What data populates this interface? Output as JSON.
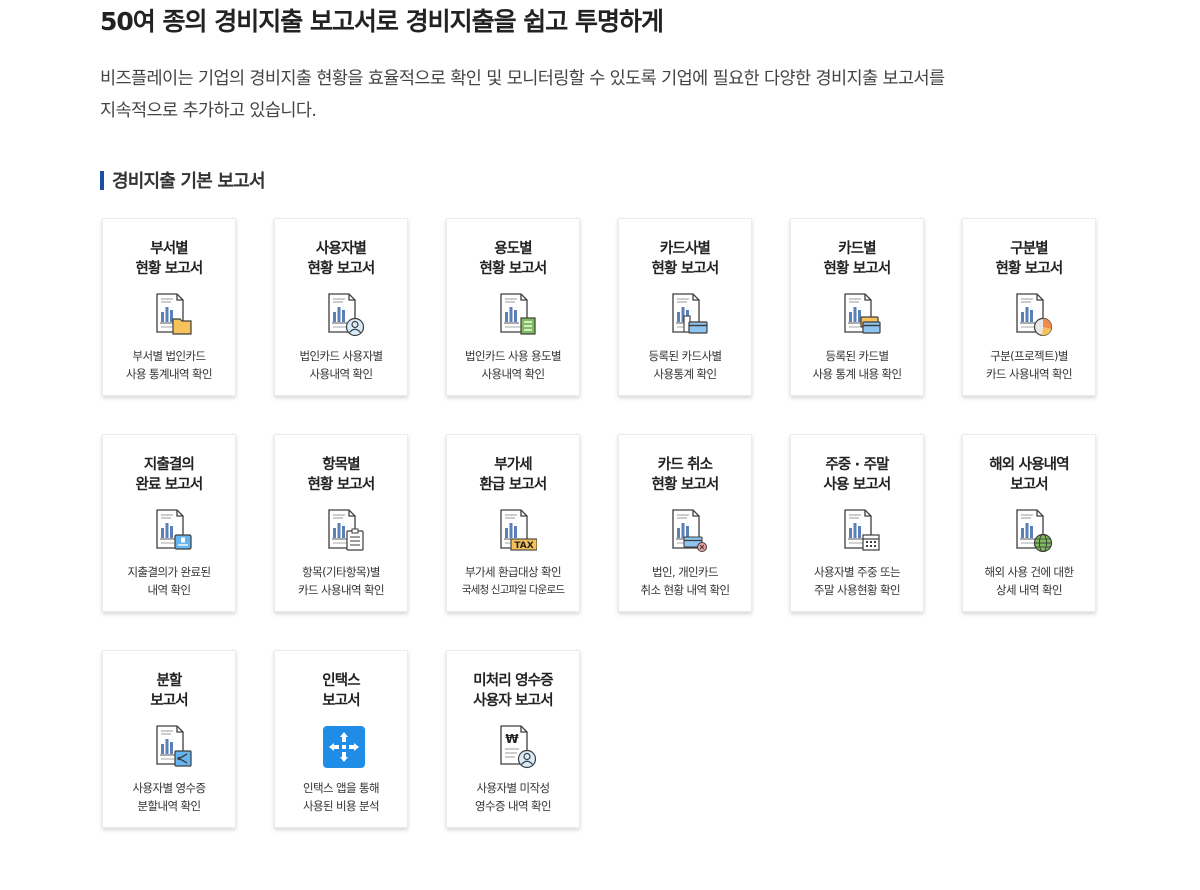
{
  "headline": "50여 종의 경비지출 보고서로 경비지출을 쉽고 투명하게",
  "intro": {
    "line1": "비즈플레이는 기업의 경비지출 현황을 효율적으로 확인 및 모니터링할 수 있도록 기업에 필요한 다양한 경비지출 보고서를",
    "line2": "지속적으로 추가하고 있습니다."
  },
  "section_title": "경비지출 기본 보고서",
  "colors": {
    "accent": "#1a4fa0",
    "doc_blue": "#5b7fb8",
    "folder_orange": "#f7c25c",
    "chart_green": "#7dbf5a",
    "intex_blue": "#1f8ce6"
  },
  "cards": [
    {
      "title1": "부서별",
      "title2": "현황 보고서",
      "desc1": "부서별 법인카드",
      "desc2": "사용 통계내역 확인",
      "icon": "folder-report-icon"
    },
    {
      "title1": "사용자별",
      "title2": "현황 보고서",
      "desc1": "법인카드 사용자별",
      "desc2": "사용내역 확인",
      "icon": "user-report-icon"
    },
    {
      "title1": "용도별",
      "title2": "현황 보고서",
      "desc1": "법인카드 사용 용도별",
      "desc2": "사용내역 확인",
      "icon": "list-report-icon"
    },
    {
      "title1": "카드사별",
      "title2": "현황 보고서",
      "desc1": "등록된 카드사별",
      "desc2": "사용통계 확인",
      "icon": "card-company-report-icon"
    },
    {
      "title1": "카드별",
      "title2": "현황 보고서",
      "desc1": "등록된 카드별",
      "desc2": "사용 통계 내용 확인",
      "icon": "cards-report-icon"
    },
    {
      "title1": "구분별",
      "title2": "현황 보고서",
      "desc1": "구분(프로젝트)별",
      "desc2": "카드 사용내역 확인",
      "icon": "pie-report-icon"
    },
    {
      "title1": "지출결의",
      "title2": "완료 보고서",
      "desc1": "지출결의가 완료된",
      "desc2": "내역 확인",
      "icon": "stamp-report-icon"
    },
    {
      "title1": "항목별",
      "title2": "현황 보고서",
      "desc1": "항목(기타항목)별",
      "desc2": "카드 사용내역 확인",
      "icon": "clipboard-report-icon"
    },
    {
      "title1": "부가세",
      "title2": "환급 보고서",
      "desc1": "부가세 환급대상 확인",
      "desc2": "국세청 신고파일 다운로드",
      "icon": "tax-report-icon",
      "tax_label": "TAX"
    },
    {
      "title1": "카드 취소",
      "title2": "현황 보고서",
      "desc1": "법인, 개인카드",
      "desc2": "취소 현황 내역 확인",
      "icon": "card-cancel-report-icon"
    },
    {
      "title1": "주중 · 주말",
      "title2": "사용 보고서",
      "desc1": "사용자별 주중 또는",
      "desc2": "주말 사용현황 확인",
      "icon": "calendar-report-icon"
    },
    {
      "title1": "해외 사용내역",
      "title2": "보고서",
      "desc1": "해외 사용 건에 대한",
      "desc2": "상세 내역 확인",
      "icon": "globe-report-icon"
    },
    {
      "title1": "분할",
      "title2": "보고서",
      "desc1": "사용자별 영수증",
      "desc2": "분할내역 확인",
      "icon": "split-report-icon"
    },
    {
      "title1": "인택스",
      "title2": "보고서",
      "desc1": "인택스 앱을 통해",
      "desc2": "사용된 비용 분석",
      "icon": "intex-app-icon"
    },
    {
      "title1": "미처리 영수증",
      "title2": "사용자 보고서",
      "desc1": "사용자별 미작성",
      "desc2": "영수증 내역 확인",
      "icon": "won-receipt-user-icon",
      "won_label": "₩"
    }
  ]
}
